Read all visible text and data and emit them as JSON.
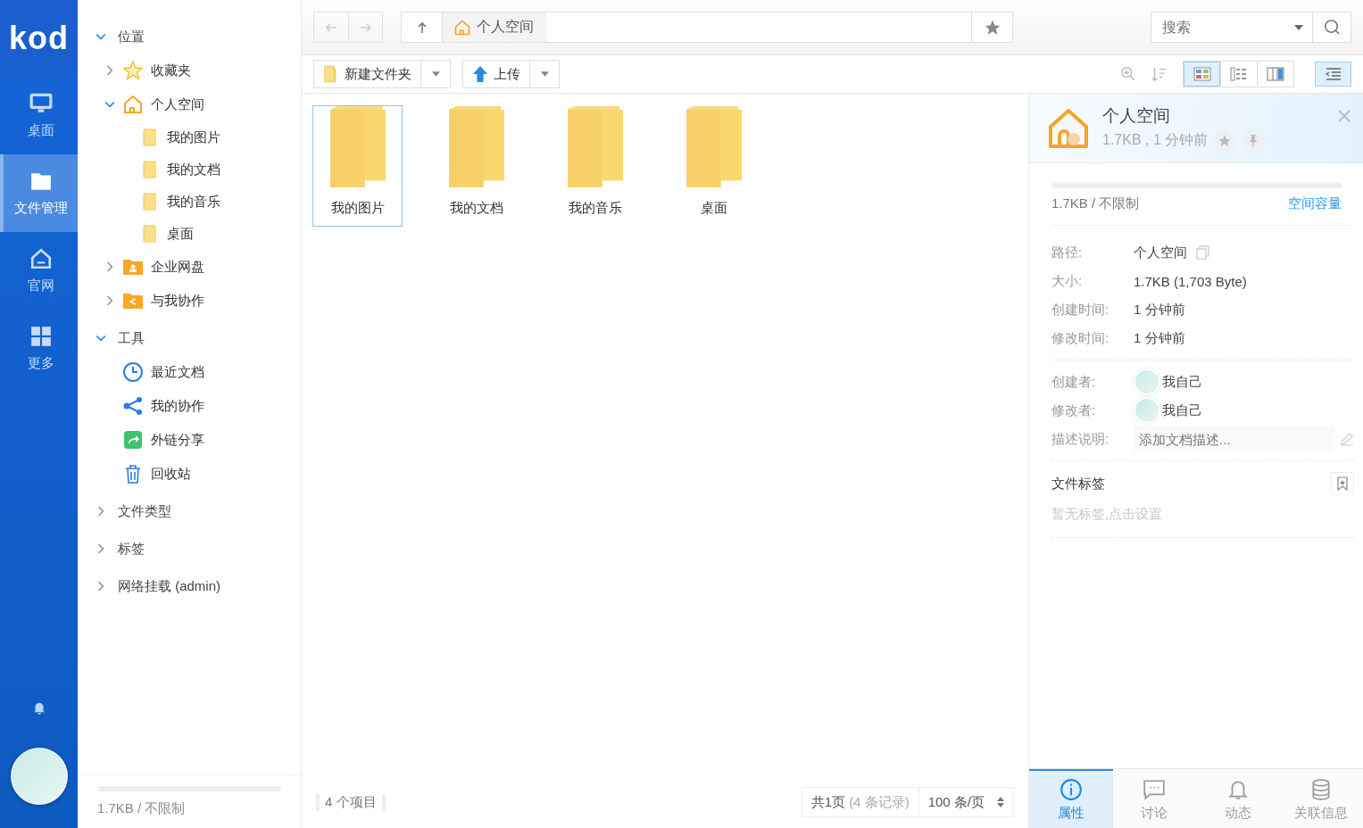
{
  "app_nav": {
    "logo": "kod",
    "items": [
      {
        "kind": "desktop",
        "label": "桌面",
        "selected": false
      },
      {
        "kind": "files",
        "label": "文件管理",
        "selected": true
      },
      {
        "kind": "home",
        "label": "官网",
        "selected": false
      },
      {
        "kind": "apps",
        "label": "更多",
        "selected": false
      }
    ]
  },
  "tree": {
    "sections": [
      {
        "label": "位置",
        "expanded": true,
        "items": [
          {
            "kind": "star",
            "label": "收藏夹",
            "expanded": false
          },
          {
            "kind": "home",
            "label": "个人空间",
            "expanded": true,
            "children": [
              {
                "label": "我的图片"
              },
              {
                "label": "我的文档"
              },
              {
                "label": "我的音乐"
              },
              {
                "label": "桌面"
              }
            ]
          },
          {
            "kind": "group",
            "label": "企业网盘",
            "expanded": false
          },
          {
            "kind": "shared",
            "label": "与我协作",
            "expanded": false
          }
        ]
      },
      {
        "label": "工具",
        "expanded": true,
        "items": [
          {
            "kind": "clock",
            "label": "最近文档"
          },
          {
            "kind": "share",
            "label": "我的协作"
          },
          {
            "kind": "link",
            "label": "外链分享"
          },
          {
            "kind": "trash",
            "label": "回收站"
          }
        ]
      },
      {
        "label": "文件类型",
        "expanded": false
      },
      {
        "label": "标签",
        "expanded": false
      },
      {
        "label": "网络挂载 (admin)",
        "expanded": false
      }
    ],
    "usage": {
      "text": "1.7KB / 不限制"
    }
  },
  "path_bar": {
    "crumb": "个人空间"
  },
  "search": {
    "placeholder": "搜索"
  },
  "toolbar": {
    "new_folder": "新建文件夹",
    "upload": "上传",
    "views": [
      {
        "kind": "icons",
        "selected": true
      },
      {
        "kind": "list",
        "selected": false
      },
      {
        "kind": "split",
        "selected": false
      }
    ],
    "panel_toggle": {
      "selected": true
    }
  },
  "files": [
    {
      "name": "我的图片",
      "selected": true
    },
    {
      "name": "我的文档",
      "selected": false
    },
    {
      "name": "我的音乐",
      "selected": false
    },
    {
      "name": "桌面",
      "selected": false
    }
  ],
  "status_bar": {
    "count": "4 个项目",
    "pages": "共1页",
    "records": "(4 条记录)",
    "page_size": "100 条/页"
  },
  "details": {
    "title": "个人空间",
    "meta": "1.7KB , 1 分钟前",
    "usage": {
      "text": "1.7KB / 不限制",
      "link": "空间容量"
    },
    "props": [
      {
        "label": "路径:",
        "value": "个人空间",
        "copy": true
      },
      {
        "label": "大小:",
        "value": "1.7KB (1,703 Byte)"
      },
      {
        "label": "创建时间:",
        "value": "1 分钟前"
      },
      {
        "label": "修改时间:",
        "value": "1 分钟前"
      }
    ],
    "people": [
      {
        "label": "创建者:",
        "value": "我自己"
      },
      {
        "label": "修改者:",
        "value": "我自己"
      }
    ],
    "description": {
      "label": "描述说明:",
      "placeholder": "添加文档描述..."
    },
    "tags": {
      "heading": "文件标签",
      "empty": "暂无标签,点击设置"
    },
    "tabs": [
      {
        "kind": "info",
        "label": "属性",
        "selected": true
      },
      {
        "kind": "chat",
        "label": "讨论",
        "selected": false
      },
      {
        "kind": "bell",
        "label": "动态",
        "selected": false
      },
      {
        "kind": "db",
        "label": "关联信息",
        "selected": false
      }
    ]
  }
}
